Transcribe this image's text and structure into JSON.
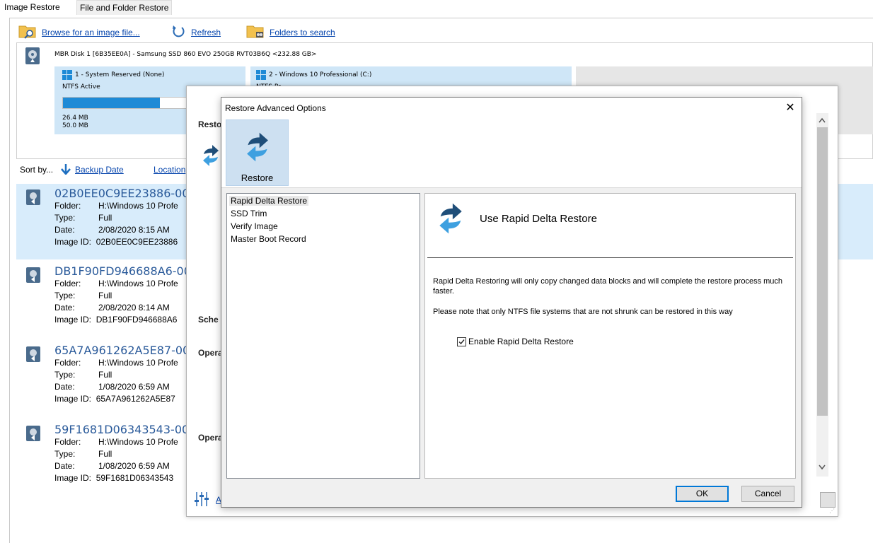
{
  "tabs": [
    "Image Restore",
    "File and Folder Restore"
  ],
  "toolbar": {
    "browse_label": "Browse for an image file...",
    "refresh_label": "Refresh",
    "folders_label": "Folders to search"
  },
  "disk": {
    "header": "MBR Disk 1 [6B35EE0A] - Samsung SSD 860 EVO 250GB RVT03B6Q  <232.88 GB>",
    "partitions": [
      {
        "name": "1 - System Reserved (None)",
        "fs": "NTFS Active",
        "used": "26.4 MB",
        "total": "50.0 MB",
        "fill_fraction": 0.53
      },
      {
        "name": "2 - Windows 10 Professional (C:)",
        "fs": "NTFS Pr"
      }
    ]
  },
  "sort": {
    "label": "Sort by...",
    "backup_date": "Backup Date",
    "location": "Location"
  },
  "backups": [
    {
      "title": "02B0EE0C9EE23886-00-",
      "folder": "H:\\Windows 10 Profe",
      "type": "Full",
      "date": "2/08/2020 8:15 AM",
      "image_id": "02B0EE0C9EE23886"
    },
    {
      "title": "DB1F90FD946688A6-00",
      "folder": "H:\\Windows 10 Profe",
      "type": "Full",
      "date": "2/08/2020 8:14 AM",
      "image_id": "DB1F90FD946688A6"
    },
    {
      "title": "65A7A961262A5E87-00",
      "folder": "H:\\Windows 10 Profe",
      "type": "Full",
      "date": "1/08/2020 6:59 AM",
      "image_id": "65A7A961262A5E87"
    },
    {
      "title": "59F1681D06343543-00",
      "folder": "H:\\Windows 10 Profe",
      "type": "Full",
      "date": "1/08/2020 6:59 AM",
      "image_id": "59F1681D06343543"
    }
  ],
  "row_keys": {
    "folder": "Folder:",
    "type": "Type:",
    "date": "Date:",
    "image_id": "Image ID:"
  },
  "behind": {
    "restore_label": "Resto",
    "sched_label": "Sche",
    "opera1_label": "Opera",
    "opera2_label": "Opera",
    "bottom_link": "A"
  },
  "dialog": {
    "title": "Restore Advanced Options",
    "close": "✕",
    "ribbon_label": "Restore",
    "options": [
      "Rapid Delta Restore",
      "SSD Trim",
      "Verify Image",
      "Master Boot Record"
    ],
    "content_title": "Use Rapid Delta Restore",
    "para1": "Rapid Delta Restoring will only copy changed data blocks and will complete the restore process much faster.",
    "para2": "Please note that only NTFS file systems that are not shrunk can be restored in this way",
    "checkbox_label": "Enable Rapid Delta Restore",
    "checkbox_checked": true,
    "ok": "OK",
    "cancel": "Cancel"
  },
  "colors": {
    "accent": "#1e8ad6",
    "link": "#0645ad",
    "selection": "#d8ecfb",
    "title_blue": "#2a5a9a"
  }
}
